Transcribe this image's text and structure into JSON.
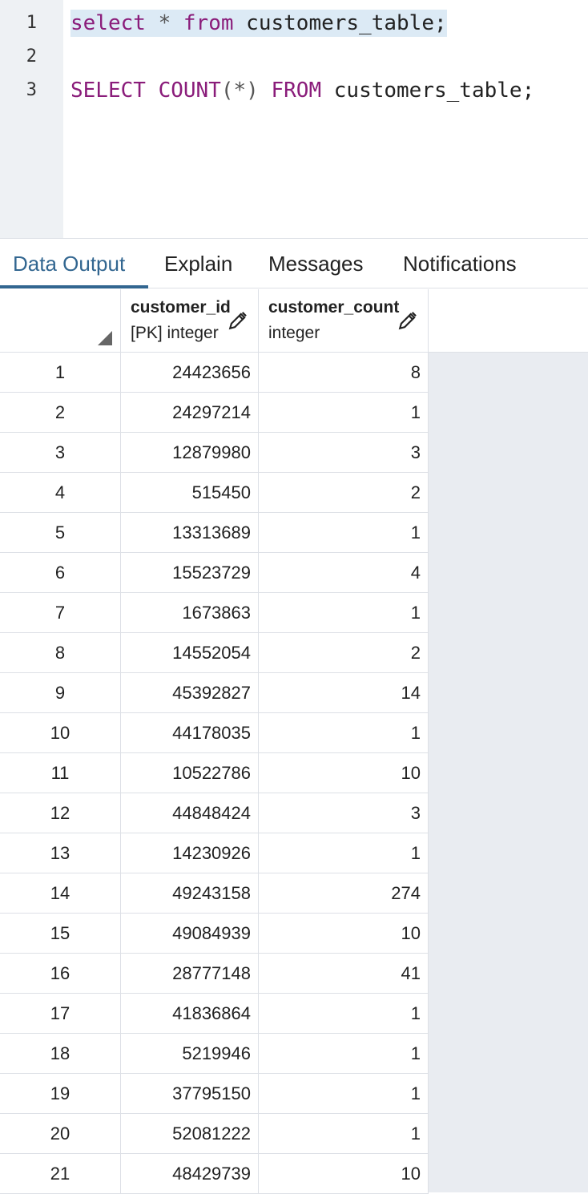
{
  "editor": {
    "line_numbers": [
      "1",
      "2",
      "3"
    ],
    "line1": {
      "kw1": "select",
      "star": "*",
      "kw2": "from",
      "rest": "customers_table;"
    },
    "line3": {
      "kw1": "SELECT",
      "fn": "COUNT",
      "args": "(*)",
      "kw2": "FROM",
      "rest": "customers_table;"
    }
  },
  "tabs": [
    "Data Output",
    "Explain",
    "Messages",
    "Notifications"
  ],
  "active_tab": "Data Output",
  "grid": {
    "columns": [
      {
        "name": "customer_id",
        "type": "[PK] integer"
      },
      {
        "name": "customer_count",
        "type": "integer"
      }
    ],
    "rows": [
      [
        "1",
        "24423656",
        "8"
      ],
      [
        "2",
        "24297214",
        "1"
      ],
      [
        "3",
        "12879980",
        "3"
      ],
      [
        "4",
        "515450",
        "2"
      ],
      [
        "5",
        "13313689",
        "1"
      ],
      [
        "6",
        "15523729",
        "4"
      ],
      [
        "7",
        "1673863",
        "1"
      ],
      [
        "8",
        "14552054",
        "2"
      ],
      [
        "9",
        "45392827",
        "14"
      ],
      [
        "10",
        "44178035",
        "1"
      ],
      [
        "11",
        "10522786",
        "10"
      ],
      [
        "12",
        "44848424",
        "3"
      ],
      [
        "13",
        "14230926",
        "1"
      ],
      [
        "14",
        "49243158",
        "274"
      ],
      [
        "15",
        "49084939",
        "10"
      ],
      [
        "16",
        "28777148",
        "41"
      ],
      [
        "17",
        "41836864",
        "1"
      ],
      [
        "18",
        "5219946",
        "1"
      ],
      [
        "19",
        "37795150",
        "1"
      ],
      [
        "20",
        "52081222",
        "1"
      ],
      [
        "21",
        "48429739",
        "10"
      ]
    ]
  },
  "colors": {
    "accent": "#326690",
    "keyword": "#8a1c7a",
    "selection": "#dceaf5",
    "gutter": "#eef1f4",
    "grid_empty": "#e9ecf1"
  }
}
